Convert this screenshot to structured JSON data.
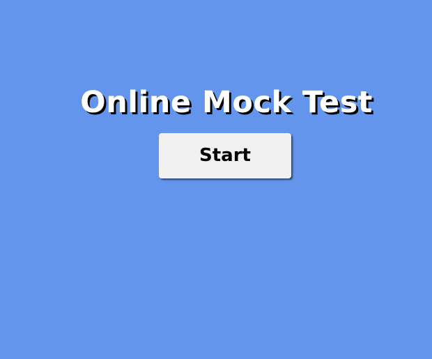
{
  "page": {
    "background_color": "#6495ED"
  },
  "header": {
    "title": "Online Mock Test"
  },
  "actions": {
    "start_label": "Start"
  }
}
